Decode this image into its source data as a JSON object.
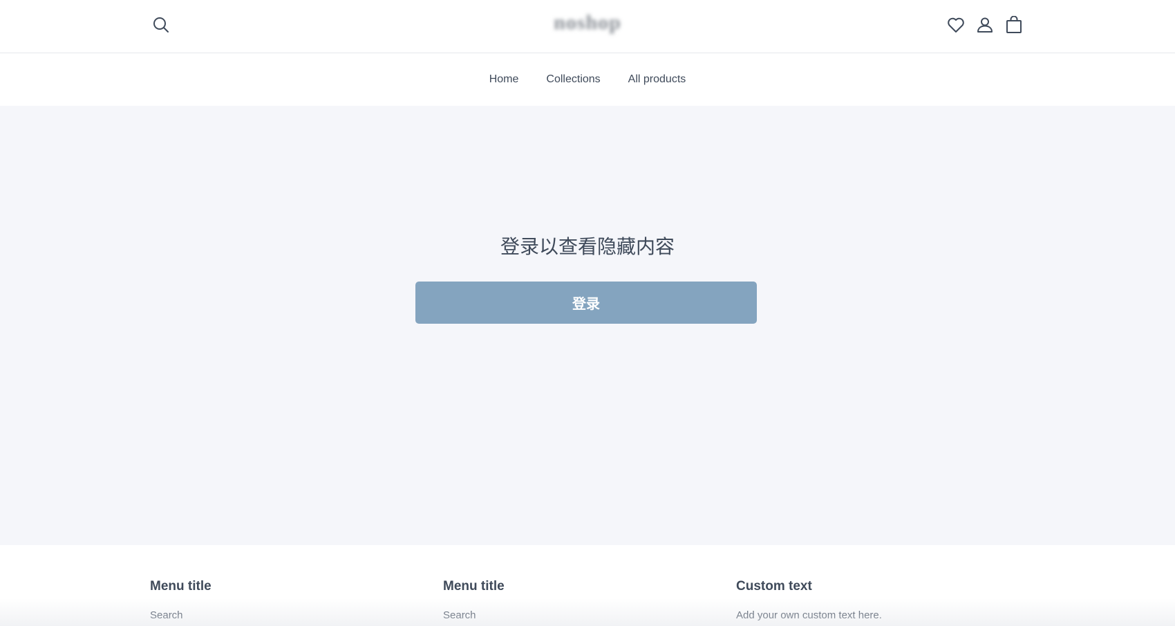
{
  "header": {
    "logo_text": "noshop",
    "icons": {
      "search": "search-icon",
      "wishlist": "heart-icon",
      "account": "user-icon",
      "cart": "shopping-bag-icon"
    }
  },
  "nav": {
    "items": [
      {
        "label": "Home"
      },
      {
        "label": "Collections"
      },
      {
        "label": "All products"
      }
    ]
  },
  "main": {
    "title": "登录以查看隐藏内容",
    "login_button": "登录",
    "button_color": "#84a4bf",
    "background_color": "#f5f6fa"
  },
  "footer": {
    "columns": [
      {
        "title": "Menu title",
        "link": "Search"
      },
      {
        "title": "Menu title",
        "link": "Search"
      },
      {
        "title": "Custom text",
        "text": "Add your own custom text here."
      }
    ]
  }
}
